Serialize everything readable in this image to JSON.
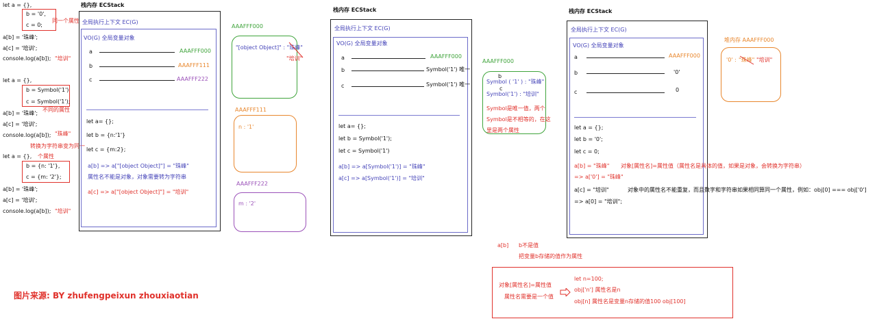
{
  "left_code": {
    "b1": [
      "let a = {},",
      "b = '0',",
      "c = 0;",
      "a[b] = '珠峰';",
      "a[c] = '培训';",
      "console.log(a[b]);",
      "\"培训\""
    ],
    "note1": "同一个属性",
    "b2": [
      "let a = {},",
      "b = Symbol('1')",
      "c = Symbol('1');",
      "a[b] = '珠峰';",
      "a[c] = '培训';",
      "console.log(a[b]);",
      "\"珠峰\""
    ],
    "note2": "不同的属性",
    "note2b": "转换为字符串变为同一",
    "b3": [
      "let a = {},",
      "b = {n: '1'},",
      "c = {m: '2'};",
      "a[b] = '珠峰';",
      "a[c] = '培训';",
      "console.log(a[b]);",
      "\"培训\""
    ],
    "note3": "个属性",
    "credit": "图片来源:  BY zhufengpeixun zhouxiaotian"
  },
  "diagram1": {
    "title": "栈内存 ECStack",
    "ec": "全局执行上下文 EC(G)",
    "vo": "VO(G) 全局变量对象",
    "vars": [
      "a",
      "b",
      "c"
    ],
    "addrs": [
      "AAAFFF000",
      "AAAFFF111",
      "AAAFFF222"
    ],
    "code": [
      "let a= {};",
      "let b = {n:'1'}",
      "let c = {m:2};"
    ],
    "exp1": "a[b] => a[\"[object Object]\"] = \"珠峰\"",
    "exp2": "属性名不能是对象，对象需要转为字符串",
    "exp3": "a[c] => a[\"[object Object]\"] = \"培训\"",
    "heap1_addr": "AAAFFF000",
    "heap1_line1": "\"[object Object]\" : \"珠峰\"",
    "heap1_line2": "\"培训\"",
    "heap2_addr": "AAAFFF111",
    "heap2_text": "n : '1'",
    "heap3_addr": "AAAFFF222",
    "heap3_text": "m : '2'"
  },
  "diagram2": {
    "title": "栈内存 ECStack",
    "ec": "全局执行上下文 EC(G)",
    "vo": "VO(G) 全局变量对象",
    "vars": [
      "a",
      "b",
      "c"
    ],
    "vals": [
      "AAAFFF000",
      "Symbol('1') 唯一",
      "Symbol('1') 唯一"
    ],
    "code": [
      "let a= {};",
      "let b = Symbol('1');",
      "let c = Symbol('1')"
    ],
    "exp1": "a[b]  => a[Symbol('1')] = \"珠峰\"",
    "exp2": "a[c] => a[Symbol('1')] = \"培训\"",
    "heap_addr": "AAAFFF000",
    "heap_b": "b",
    "heap_c": "c",
    "heap_l1": "Symbol ( '1' )  :  \"珠峰\"",
    "heap_l2": "Symbol('1')  :  \"培训\"",
    "heap_n1": "Symbol是唯一值，两个",
    "heap_n2": "Symbol是不相等的，在这",
    "heap_n3": "里是两个属性"
  },
  "diagram3": {
    "title": "栈内存 ECStack",
    "ec": "全局执行上下文 EC(G)",
    "vo": "VO(G) 全局变量对象",
    "vars": [
      "a",
      "b",
      "c"
    ],
    "vals": [
      "AAAFFF000",
      "'0'",
      "0"
    ],
    "code": [
      "let a = {};",
      "let b = '0';",
      "let c = 0;"
    ],
    "e1a": "a[b] = \"珠峰\"",
    "e1b": "对象[属性名]=属性值（属性名是具体的值，如果是对象，会转换为字符串）",
    "e1c": "=> a['0'] = \"珠峰\"",
    "e2a": "a[c] = \"培训\"",
    "e2b": "对象中的属性名不能重复，而且数字和字符串如果相同算同一个属性，例如：obj[0] === obj['0']",
    "e2c": "=> a[0] = \"培训\";",
    "heap_title": "堆内存 AAAFFF000",
    "heap_l1": "'0' :",
    "heap_l2": "\"珠峰\"",
    "heap_l3": "\"培训\""
  },
  "bottom_note": {
    "l1a": "a[b]",
    "l1b": "b不是值",
    "l2": "把变量b存储的值作为属性",
    "box_left1": "对象[属性名]=属性值",
    "box_left2": "属性名需要是一个值",
    "box_r1": "let n=100;",
    "box_r2": "obj['n']  属性名是n",
    "box_r3": "obj[n]  属性名是变量n存储的值100    obj[100]"
  }
}
